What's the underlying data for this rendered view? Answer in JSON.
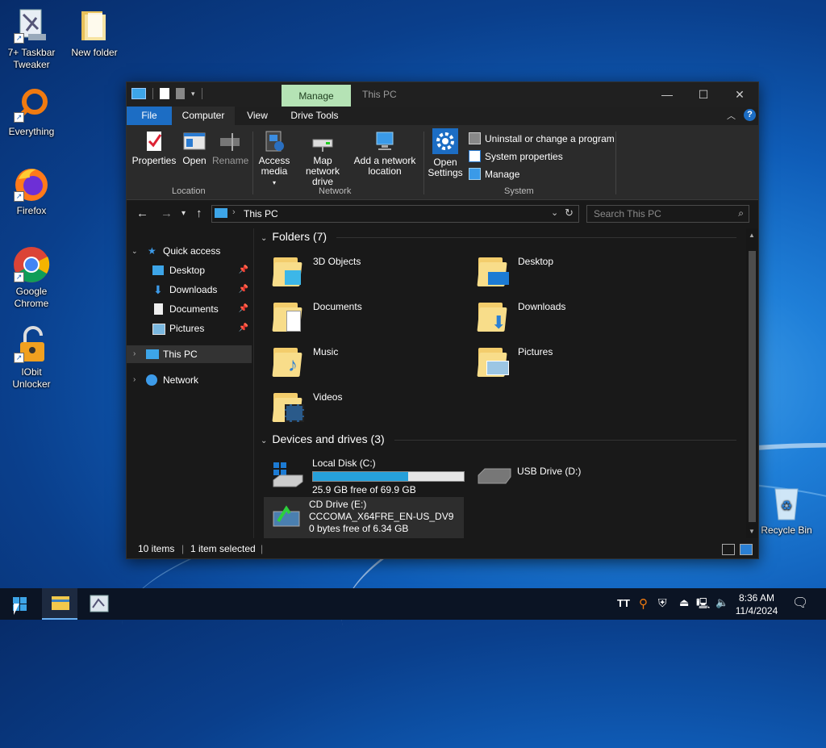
{
  "desktop": {
    "icons": [
      {
        "label": "7+ Taskbar Tweaker"
      },
      {
        "label": "New folder"
      },
      {
        "label": "Everything"
      },
      {
        "label": "Firefox"
      },
      {
        "label": "Google Chrome"
      },
      {
        "label": "IObit Unlocker"
      },
      {
        "label": "Recycle Bin"
      }
    ]
  },
  "window": {
    "context_tab": "Manage",
    "title": "This PC",
    "tabs": [
      "File",
      "Computer",
      "View",
      "Drive Tools"
    ],
    "ribbon": {
      "location": {
        "label": "Location",
        "buttons": [
          "Properties",
          "Open",
          "Rename"
        ]
      },
      "network": {
        "label": "Network",
        "buttons": [
          "Access media",
          "Map network drive",
          "Add a network location"
        ]
      },
      "system": {
        "label": "System",
        "open_settings": "Open Settings",
        "items": [
          "Uninstall or change a program",
          "System properties",
          "Manage"
        ]
      }
    },
    "address": {
      "path": "This PC",
      "search_placeholder": "Search This PC"
    },
    "nav": {
      "quick_access": "Quick access",
      "pinned": [
        "Desktop",
        "Downloads",
        "Documents",
        "Pictures"
      ],
      "this_pc": "This PC",
      "network": "Network"
    },
    "folders_header": "Folders (7)",
    "folders": [
      "3D Objects",
      "Desktop",
      "Documents",
      "Downloads",
      "Music",
      "Pictures",
      "Videos"
    ],
    "drives_header": "Devices and drives (3)",
    "drives": {
      "c": {
        "name": "Local Disk (C:)",
        "free": "25.9 GB free of 69.9 GB",
        "used_fraction": 0.63
      },
      "d": {
        "name": "USB Drive (D:)"
      },
      "e": {
        "name": "CD Drive (E:)",
        "label": "CCCOMA_X64FRE_EN-US_DV9",
        "free": "0 bytes free of 6.34 GB"
      }
    },
    "status": {
      "items": "10 items",
      "selected": "1 item selected"
    }
  },
  "taskbar": {
    "time": "8:36 AM",
    "date": "11/4/2024"
  },
  "colors": {
    "accent": "#1c6dc4",
    "context_tab": "#b5e3b5",
    "progress": "#26a0da"
  }
}
